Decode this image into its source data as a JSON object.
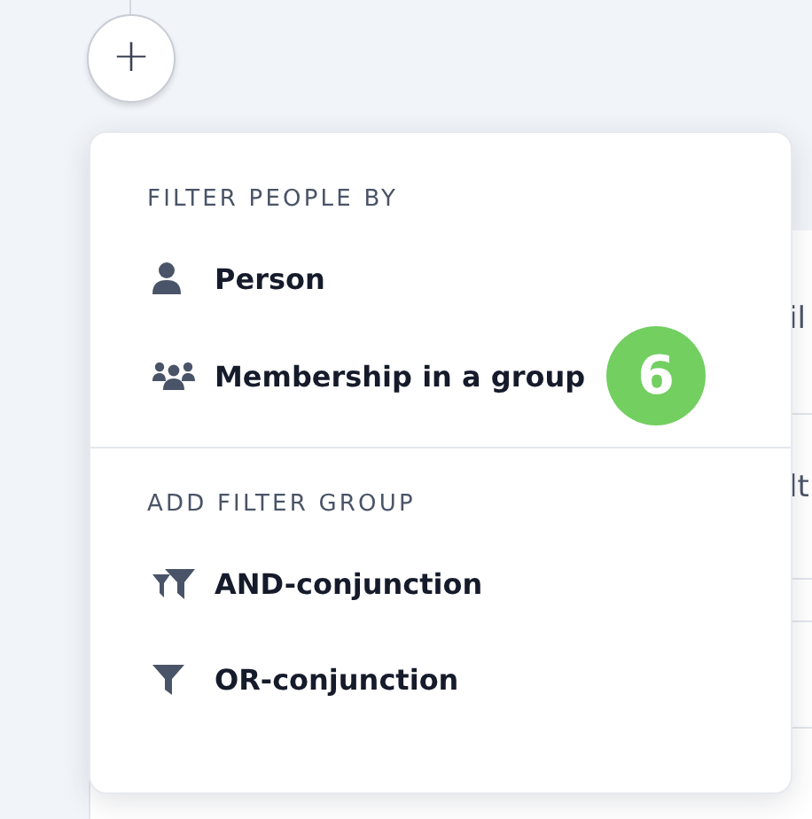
{
  "add_button": {
    "label": "+"
  },
  "background_texts": [
    "il",
    "lt"
  ],
  "menu": {
    "sections": [
      {
        "heading": "FILTER PEOPLE BY",
        "items": [
          {
            "label": "Person",
            "kind": "person"
          },
          {
            "label": "Membership in a group",
            "kind": "group",
            "badge": "6"
          }
        ]
      },
      {
        "heading": "ADD FILTER GROUP",
        "items": [
          {
            "label": "AND-conjunction",
            "kind": "and"
          },
          {
            "label": "OR-conjunction",
            "kind": "or"
          }
        ]
      }
    ]
  }
}
